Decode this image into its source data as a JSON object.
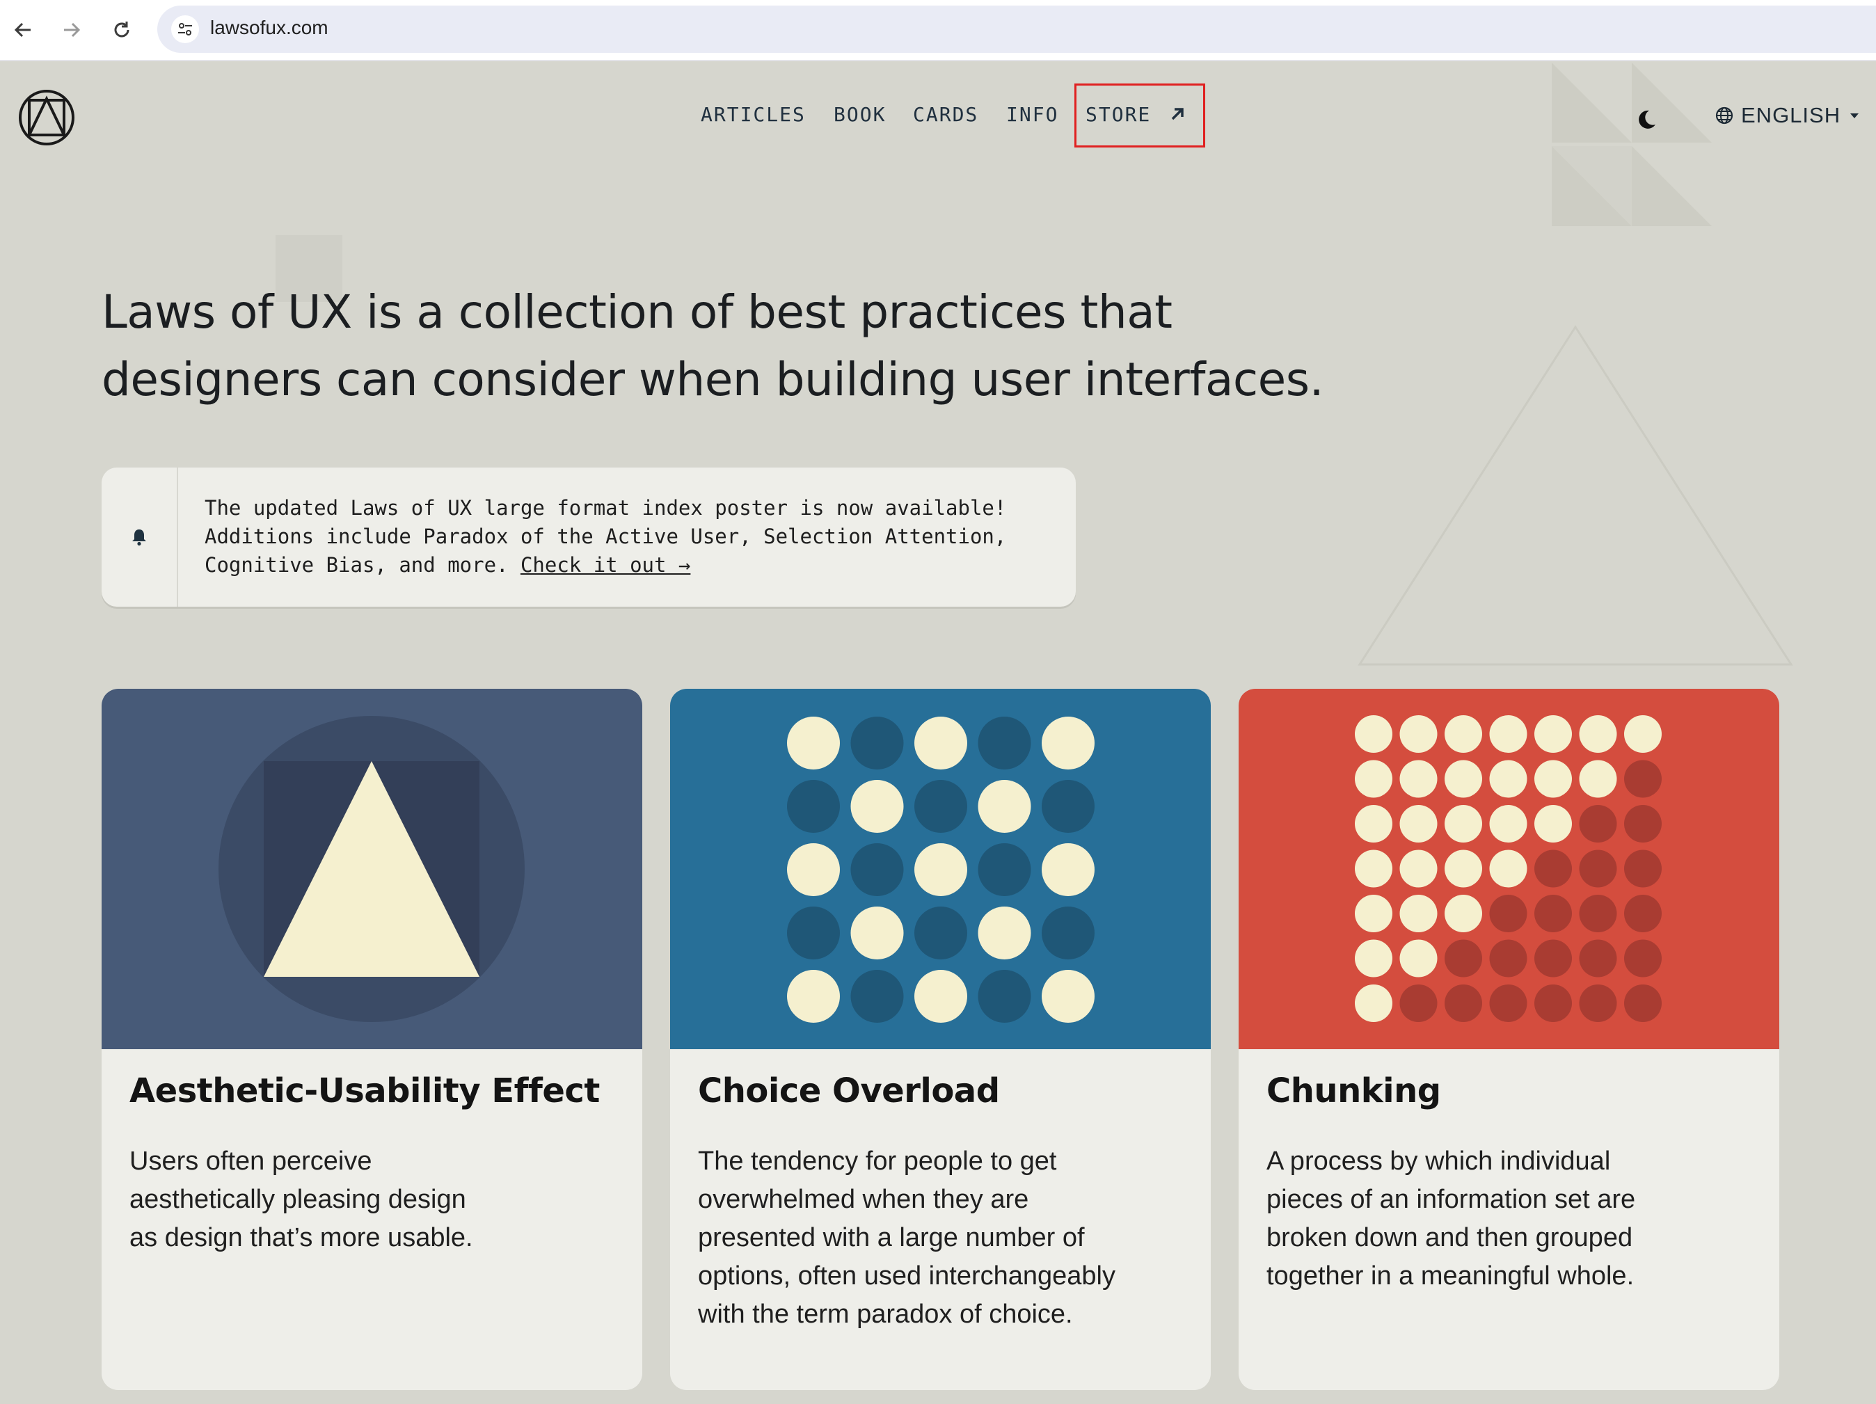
{
  "browser": {
    "url": "lawsofux.com",
    "back_icon": "arrow-left-icon",
    "forward_icon": "arrow-right-icon",
    "reload_icon": "reload-icon"
  },
  "header": {
    "nav": [
      {
        "label": "ARTICLES"
      },
      {
        "label": "BOOK"
      },
      {
        "label": "CARDS"
      },
      {
        "label": "INFO"
      },
      {
        "label": "STORE"
      }
    ],
    "language": "ENGLISH",
    "highlight_color": "#e02020"
  },
  "hero": {
    "line1": "Laws of UX is a collection of best practices that",
    "line2": "designers can consider when building user interfaces."
  },
  "notice": {
    "line1": "The updated Laws of UX large format index poster is now available!",
    "line2": "Additions include Paradox of the Active User, Selection Attention,",
    "line3_prefix": "Cognitive Bias, and more. ",
    "link": "Check it out →"
  },
  "cards": [
    {
      "title": "Aesthetic-Usability Effect",
      "desc_lines": [
        "Users often perceive",
        "aesthetically pleasing design",
        "as design that’s more usable."
      ],
      "color": "#475a78"
    },
    {
      "title": "Choice Overload",
      "desc_lines": [
        "The tendency for people to get",
        "overwhelmed when they are",
        "presented with a large number of",
        "options, often used interchangeably",
        "with the term paradox of choice."
      ],
      "color": "#276f98"
    },
    {
      "title": "Chunking",
      "desc_lines": [
        "A process by which individual",
        "pieces of an information set are",
        "broken down and then grouped",
        "together in a meaningful whole."
      ],
      "color": "#d44d3e"
    }
  ]
}
